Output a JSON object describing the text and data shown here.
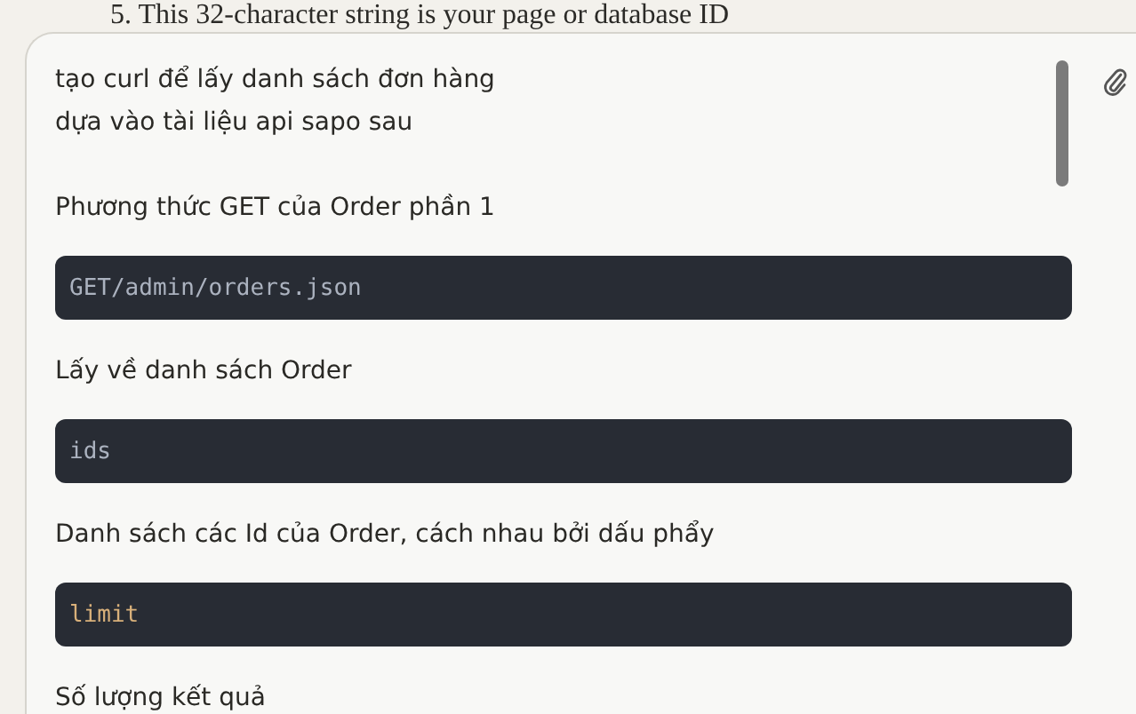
{
  "background_text": "5. This 32-character string is your page or database ID",
  "message": [
    {
      "kind": "text",
      "text": "tạo curl để lấy danh sách đơn hàng\ndựa vào tài liệu api sapo sau"
    },
    {
      "kind": "text",
      "text": "Phương thức GET của Order phần 1"
    },
    {
      "kind": "code",
      "text": "GET/admin/orders.json",
      "highlight": false
    },
    {
      "kind": "text",
      "text": "Lấy về danh sách Order"
    },
    {
      "kind": "code",
      "text": "ids",
      "highlight": false
    },
    {
      "kind": "text",
      "text": "Danh sách các Id của Order, cách nhau bởi dấu phẩy"
    },
    {
      "kind": "code",
      "text": "limit",
      "highlight": true
    },
    {
      "kind": "text",
      "text": "Số lượng kết quả"
    }
  ]
}
